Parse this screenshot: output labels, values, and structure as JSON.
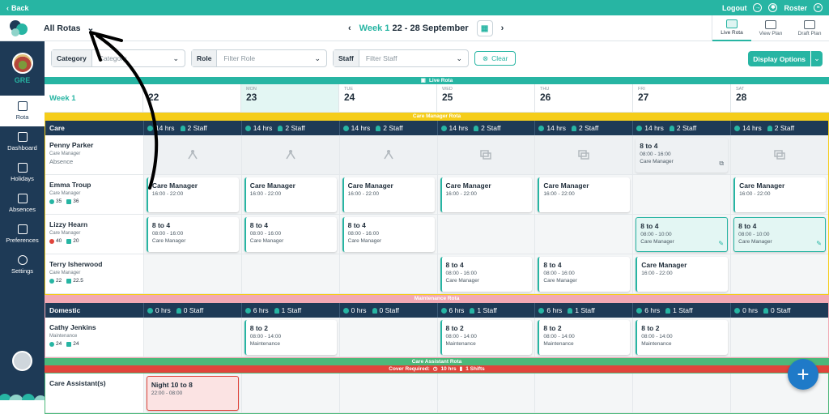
{
  "topbar": {
    "back_label": "Back",
    "logout_label": "Logout",
    "roster_label": "Roster"
  },
  "header": {
    "rota_select": "All Rotas",
    "week_label": "Week 1",
    "date_range": "22 - 28 September",
    "views": [
      {
        "label": "Live Rota",
        "active": true
      },
      {
        "label": "View Plan",
        "active": false
      },
      {
        "label": "Draft Plan",
        "active": false
      }
    ]
  },
  "sidebar": {
    "org_code": "GRE",
    "items": [
      {
        "label": "Rota",
        "icon": "calendar-icon",
        "active": true
      },
      {
        "label": "Dashboard",
        "icon": "dashboard-icon",
        "active": false
      },
      {
        "label": "Holidays",
        "icon": "holiday-icon",
        "active": false
      },
      {
        "label": "Absences",
        "icon": "absences-icon",
        "active": false
      },
      {
        "label": "Preferences",
        "icon": "preferences-icon",
        "active": false
      },
      {
        "label": "Settings",
        "icon": "gear-icon",
        "active": false
      }
    ]
  },
  "filters": {
    "category_label": "Category",
    "category_placeholder": "Category",
    "role_label": "Role",
    "role_placeholder": "Filter Role",
    "staff_label": "Staff",
    "staff_placeholder": "Filter Staff",
    "clear_label": "Clear",
    "display_options_label": "Display Options"
  },
  "grid": {
    "live_rota_label": "Live Rota",
    "week_label": "Week 1",
    "days": [
      {
        "name": "MON",
        "date": "23",
        "today": true
      },
      {
        "name": "TUE",
        "date": "24",
        "today": false
      },
      {
        "name": "WED",
        "date": "25",
        "today": false
      },
      {
        "name": "THU",
        "date": "26",
        "today": false
      },
      {
        "name": "FRI",
        "date": "27",
        "today": false
      },
      {
        "name": "SAT",
        "date": "28",
        "today": false
      }
    ],
    "first_day_date": "22",
    "sections": [
      {
        "banner": "Care Manager Rota",
        "banner_color": "#f5cd1a",
        "border_color": "#f5cd1a",
        "header": "Care",
        "totals": [
          {
            "hrs": "14 hrs",
            "staff": "2 Staff"
          },
          {
            "hrs": "14 hrs",
            "staff": "2 Staff"
          },
          {
            "hrs": "14 hrs",
            "staff": "2 Staff"
          },
          {
            "hrs": "14 hrs",
            "staff": "2 Staff"
          },
          {
            "hrs": "14 hrs",
            "staff": "2 Staff"
          },
          {
            "hrs": "14 hrs",
            "staff": "2 Staff"
          },
          {
            "hrs": "14 hrs",
            "staff": "2 Staff"
          }
        ],
        "rows": [
          {
            "name": "Penny Parker",
            "role": "Care Manager",
            "sub": "Absence",
            "absence": true,
            "cells": [
              {
                "type": "absence",
                "icon": "holiday-icon"
              },
              {
                "type": "absence",
                "icon": "holiday-icon"
              },
              {
                "type": "absence",
                "icon": "holiday-icon"
              },
              {
                "type": "absence",
                "icon": "swap-icon"
              },
              {
                "type": "absence",
                "icon": "swap-icon"
              },
              {
                "type": "grey",
                "title": "8 to 4",
                "hours": "08:00 - 16:00",
                "role": "Care Manager",
                "icon": "swap-icon"
              },
              {
                "type": "absence",
                "icon": "swap-icon"
              }
            ]
          },
          {
            "name": "Emma Troup",
            "role": "Care Manager",
            "stats": [
              {
                "v": "35"
              },
              {
                "v": "36"
              }
            ],
            "cells": [
              {
                "type": "shift",
                "title": "Care Manager",
                "hours": "16:00 - 22:00"
              },
              {
                "type": "shift",
                "title": "Care Manager",
                "hours": "16:00 - 22:00"
              },
              {
                "type": "shift",
                "title": "Care Manager",
                "hours": "16:00 - 22:00"
              },
              {
                "type": "shift",
                "title": "Care Manager",
                "hours": "16:00 - 22:00"
              },
              {
                "type": "shift",
                "title": "Care Manager",
                "hours": "16:00 - 22:00"
              },
              {
                "type": "empty"
              },
              {
                "type": "shift",
                "title": "Care Manager",
                "hours": "16:00 - 22:00"
              }
            ]
          },
          {
            "name": "Lizzy Hearn",
            "role": "Care Manager",
            "stats": [
              {
                "v": "40",
                "red": true
              },
              {
                "v": "20"
              }
            ],
            "cells": [
              {
                "type": "shift",
                "title": "8 to 4",
                "hours": "08:00 - 16:00",
                "role": "Care Manager"
              },
              {
                "type": "shift",
                "title": "8 to 4",
                "hours": "08:00 - 16:00",
                "role": "Care Manager"
              },
              {
                "type": "shift",
                "title": "8 to 4",
                "hours": "08:00 - 16:00",
                "role": "Care Manager"
              },
              {
                "type": "empty"
              },
              {
                "type": "empty"
              },
              {
                "type": "edited",
                "title": "8 to 4",
                "hours": "08:00 - 10:00",
                "role": "Care Manager"
              },
              {
                "type": "edited",
                "title": "8 to 4",
                "hours": "08:00 - 10:00",
                "role": "Care Manager"
              }
            ]
          },
          {
            "name": "Terry Isherwood",
            "role": "Care Manager",
            "stats": [
              {
                "v": "22"
              },
              {
                "v": "22.5"
              }
            ],
            "cells": [
              {
                "type": "empty"
              },
              {
                "type": "empty"
              },
              {
                "type": "empty"
              },
              {
                "type": "shift",
                "title": "8 to 4",
                "hours": "08:00 - 16:00",
                "role": "Care Manager"
              },
              {
                "type": "shift",
                "title": "8 to 4",
                "hours": "08:00 - 16:00",
                "role": "Care Manager"
              },
              {
                "type": "shift",
                "title": "Care Manager",
                "hours": "16:00 - 22:00"
              },
              {
                "type": "empty"
              }
            ]
          }
        ]
      },
      {
        "banner": "Maintenance Rota",
        "banner_color": "#f2a9b4",
        "border_color": "#f2a9b4",
        "header": "Domestic",
        "totals": [
          {
            "hrs": "0 hrs",
            "staff": "0 Staff"
          },
          {
            "hrs": "6 hrs",
            "staff": "1 Staff"
          },
          {
            "hrs": "0 hrs",
            "staff": "0 Staff"
          },
          {
            "hrs": "6 hrs",
            "staff": "1 Staff"
          },
          {
            "hrs": "6 hrs",
            "staff": "1 Staff"
          },
          {
            "hrs": "6 hrs",
            "staff": "1 Staff"
          },
          {
            "hrs": "0 hrs",
            "staff": "0 Staff"
          }
        ],
        "rows": [
          {
            "name": "Cathy Jenkins",
            "role": "Maintenance",
            "stats": [
              {
                "v": "24"
              },
              {
                "v": "24"
              }
            ],
            "cells": [
              {
                "type": "empty"
              },
              {
                "type": "shift",
                "title": "8 to 2",
                "hours": "08:00 - 14:00",
                "role": "Maintenance"
              },
              {
                "type": "empty"
              },
              {
                "type": "shift",
                "title": "8 to 2",
                "hours": "08:00 - 14:00",
                "role": "Maintenance"
              },
              {
                "type": "shift",
                "title": "8 to 2",
                "hours": "08:00 - 14:00",
                "role": "Maintenance"
              },
              {
                "type": "shift",
                "title": "8 to 2",
                "hours": "08:00 - 14:00",
                "role": "Maintenance"
              },
              {
                "type": "empty"
              }
            ]
          }
        ]
      },
      {
        "banner": "Care Assistant Rota",
        "banner_color": "#4cb87a",
        "border_color": "#4cb87a",
        "cover_banner": {
          "label": "Cover Required:",
          "hrs": "10 hrs",
          "shifts": "1 Shifts"
        },
        "rows": [
          {
            "name": "Care Assistant(s)",
            "role": "",
            "cells": [
              {
                "type": "night",
                "title": "Night 10 to 8",
                "hours": "22:00 - 08:00"
              },
              {
                "type": "empty"
              },
              {
                "type": "empty"
              },
              {
                "type": "empty"
              },
              {
                "type": "empty"
              },
              {
                "type": "empty"
              },
              {
                "type": "empty"
              }
            ]
          }
        ]
      }
    ]
  },
  "colors": {
    "accent": "#27b5a3",
    "navy": "#1e3a56",
    "fab": "#1f7ac8"
  }
}
